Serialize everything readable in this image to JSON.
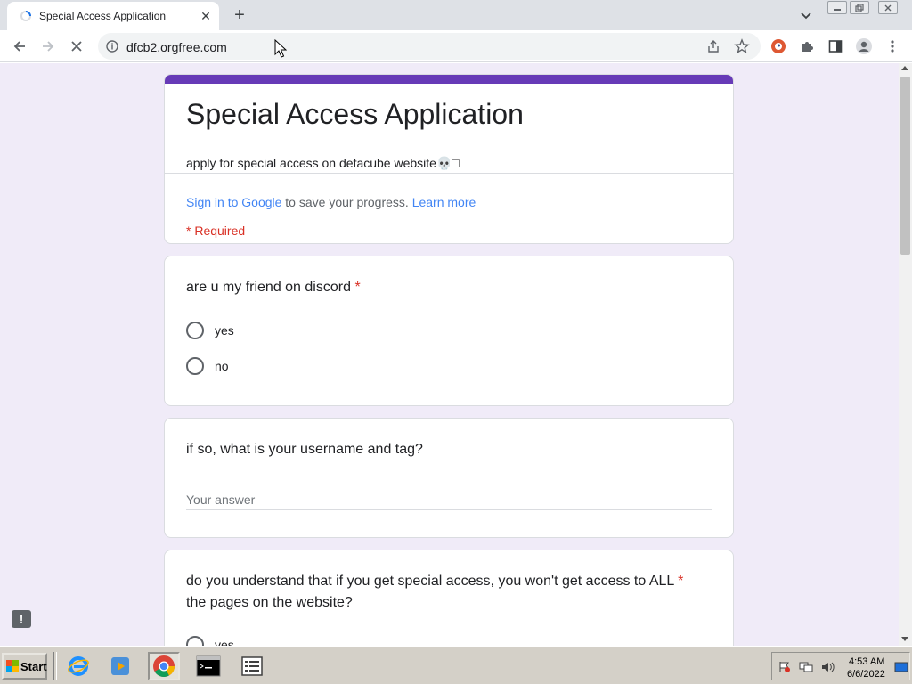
{
  "browser": {
    "tab_title": "Special Access Application",
    "url": "dfcb2.orgfree.com"
  },
  "form": {
    "title": "Special Access Application",
    "description": "apply for special access on defacube website💀□",
    "signin_link": "Sign in to Google",
    "signin_text": " to save your progress. ",
    "learn_more": "Learn more",
    "required_note": "* Required"
  },
  "questions": [
    {
      "title": "are u my friend on discord",
      "required": "*",
      "options": [
        "yes",
        "no"
      ]
    },
    {
      "title": "if so, what is your username and tag?",
      "placeholder": "Your answer"
    },
    {
      "title_line1": "do you understand that if you get special access, you won't get access to ALL",
      "title_line2": "the pages on the website?",
      "required": "*",
      "partial_option": "yes"
    }
  ],
  "taskbar": {
    "start_label": "Start",
    "time": "4:53 AM",
    "date": "6/6/2022"
  },
  "colors": {
    "accent": "#673ab7",
    "page_bg": "#f0ebf8",
    "required": "#d93025",
    "link": "#4285f4"
  }
}
